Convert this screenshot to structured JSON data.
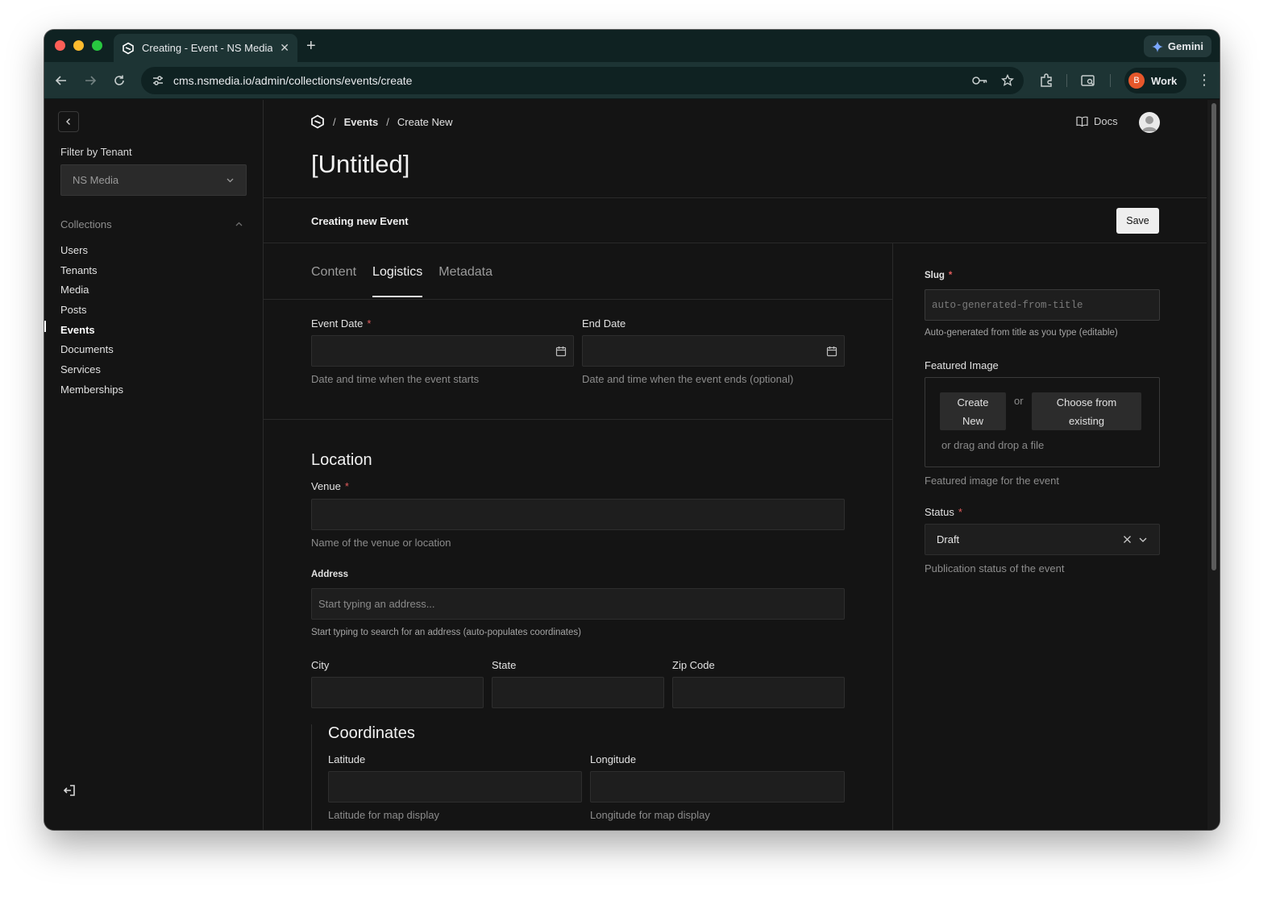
{
  "browser": {
    "tab_title": "Creating - Event - NS Media C",
    "url": "cms.nsmedia.io/admin/collections/events/create",
    "gemini_label": "Gemini",
    "profile_initial": "B",
    "profile_label": "Work"
  },
  "sidebar": {
    "filter_label": "Filter by Tenant",
    "tenant_value": "NS Media",
    "collections_heading": "Collections",
    "items": [
      {
        "label": "Users"
      },
      {
        "label": "Tenants"
      },
      {
        "label": "Media"
      },
      {
        "label": "Posts"
      },
      {
        "label": "Events",
        "active": true
      },
      {
        "label": "Documents"
      },
      {
        "label": "Services"
      },
      {
        "label": "Memberships"
      }
    ]
  },
  "header": {
    "breadcrumb": [
      "Events",
      "Create New"
    ],
    "docs_label": "Docs",
    "page_title": "[Untitled]"
  },
  "toolbar": {
    "creating_label": "Creating new Event",
    "save_label": "Save"
  },
  "tabs": [
    {
      "label": "Content",
      "active": false
    },
    {
      "label": "Logistics",
      "active": true
    },
    {
      "label": "Metadata",
      "active": false
    }
  ],
  "logistics": {
    "event_date": {
      "label": "Event Date",
      "required_mark": "*",
      "value": "",
      "help": "Date and time when the event starts"
    },
    "end_date": {
      "label": "End Date",
      "value": "",
      "help": "Date and time when the event ends (optional)"
    }
  },
  "location": {
    "heading": "Location",
    "venue": {
      "label": "Venue",
      "required_mark": "*",
      "value": "",
      "help": "Name of the venue or location"
    },
    "address": {
      "label": "Address",
      "placeholder": "Start typing an address...",
      "help": "Start typing to search for an address (auto-populates coordinates)"
    },
    "city": {
      "label": "City",
      "value": ""
    },
    "state": {
      "label": "State",
      "value": ""
    },
    "zip": {
      "label": "Zip Code",
      "value": ""
    },
    "coordinates": {
      "heading": "Coordinates",
      "latitude": {
        "label": "Latitude",
        "value": "",
        "help": "Latitude for map display"
      },
      "longitude": {
        "label": "Longitude",
        "value": "",
        "help": "Longitude for map display"
      }
    }
  },
  "side_panel": {
    "slug": {
      "label": "Slug",
      "required_mark": "*",
      "placeholder": "auto-generated-from-title",
      "help": "Auto-generated from title as you type (editable)"
    },
    "featured_image": {
      "label": "Featured Image",
      "create_line1": "Create",
      "create_line2": "New",
      "or": "or",
      "choose_line1": "Choose from",
      "choose_line2": "existing",
      "drop_text": "or drag and drop a file",
      "help": "Featured image for the event"
    },
    "status": {
      "label": "Status",
      "required_mark": "*",
      "value": "Draft",
      "help": "Publication status of the event"
    }
  },
  "colors": {
    "background": "#141414",
    "chrome": "#1d3434",
    "required": "#e25c5c",
    "profile_badge": "#e6572b"
  }
}
